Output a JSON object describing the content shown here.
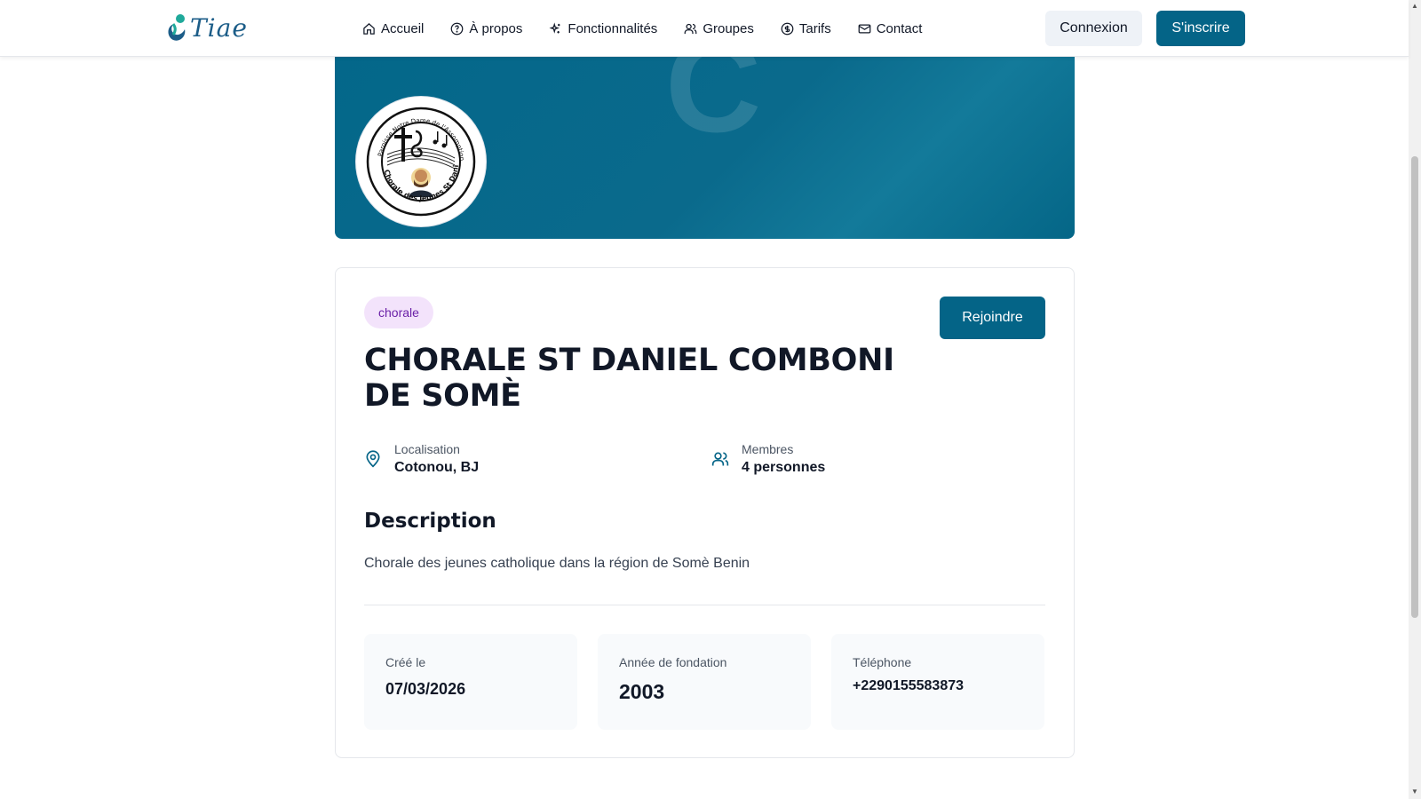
{
  "header": {
    "logo_text": "Tiae",
    "nav": [
      {
        "label": "Accueil",
        "icon": "home-icon"
      },
      {
        "label": "À propos",
        "icon": "help-circle-icon"
      },
      {
        "label": "Fonctionnalités",
        "icon": "sparkles-icon"
      },
      {
        "label": "Groupes",
        "icon": "users-icon"
      },
      {
        "label": "Tarifs",
        "icon": "dollar-circle-icon"
      },
      {
        "label": "Contact",
        "icon": "mail-icon"
      }
    ],
    "login_label": "Connexion",
    "signup_label": "S'inscrire"
  },
  "banner": {
    "initial": "C",
    "avatar_caption": "Chorale des Jeunes St Daniel Comboni",
    "avatar_caption_top": "Paroisse Notre Dame de l'Assomption de Somè"
  },
  "group": {
    "category": "chorale",
    "join_label": "Rejoindre",
    "name": "CHORALE ST DANIEL COMBONI DE SOMÈ",
    "location_label": "Localisation",
    "location_value": "Cotonou, BJ",
    "members_label": "Membres",
    "members_value": "4 personnes",
    "description_title": "Description",
    "description": "Chorale des jeunes catholique dans la région de Somè Benin",
    "stats": [
      {
        "label": "Créé le",
        "value": "07/03/2026"
      },
      {
        "label": "Année de fondation",
        "value": "2003"
      },
      {
        "label": "Téléphone",
        "value": "+2290155583873"
      }
    ]
  },
  "colors": {
    "primary": "#046487",
    "badge_bg": "#f3e3fb",
    "badge_text": "#6b21a8"
  }
}
